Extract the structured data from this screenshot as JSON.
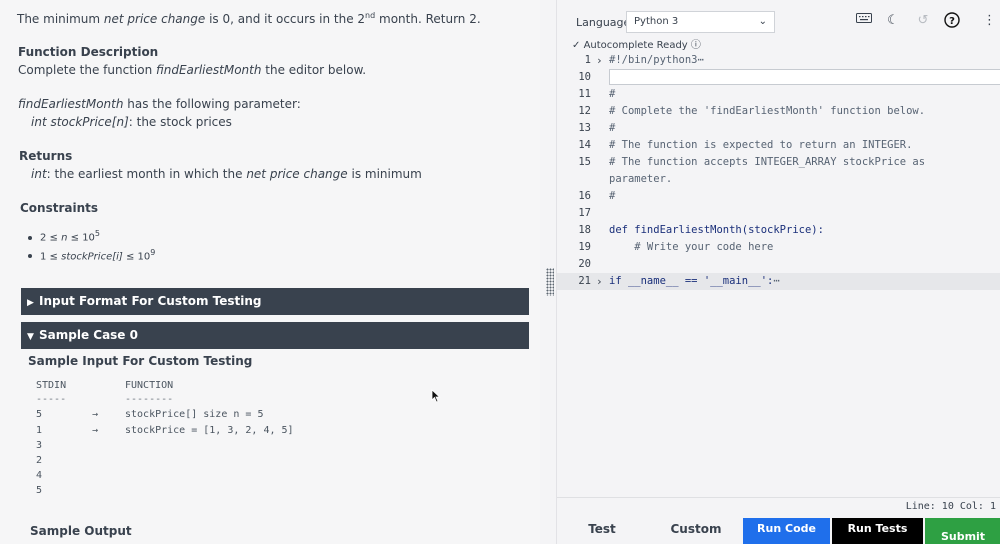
{
  "problem": {
    "intro_parts": [
      "The minimum ",
      "net price change",
      " is 0, and it occurs in the 2",
      "nd",
      " month. Return 2."
    ],
    "function_description_heading": "Function Description",
    "function_description_parts": [
      "Complete the function ",
      "findEarliestMonth",
      " the editor below."
    ],
    "param_intro_parts": [
      "findEarliestMonth",
      " has the following parameter:"
    ],
    "param_line_parts": [
      "int stockPrice[n]",
      ": the stock prices"
    ],
    "returns_heading": "Returns",
    "returns_parts": [
      "int",
      ": the earliest month in which the ",
      "net price change",
      " is minimum"
    ],
    "constraints_heading": "Constraints",
    "constraint_1_parts": [
      "2 ≤ ",
      "n",
      " ≤ 10",
      "5"
    ],
    "constraint_2_parts": [
      "1 ≤ ",
      "stockPrice[i]",
      " ≤ 10",
      "9"
    ],
    "input_format_bar": "Input Format For Custom Testing",
    "sample_case_bar": "Sample Case 0",
    "sample_input_heading": "Sample Input For Custom Testing",
    "sample_output_heading": "Sample Output",
    "stdin_header": "STDIN",
    "stdin_divider": "-----",
    "function_header": "FUNCTION",
    "function_divider": "--------",
    "stdin_rows": [
      "5",
      "1",
      "3",
      "2",
      "4",
      "5"
    ],
    "arrows": [
      "→",
      "→"
    ],
    "function_rows": [
      "stockPrice[] size n = 5",
      "stockPrice = [1, 3, 2, 4, 5]"
    ]
  },
  "editor": {
    "language_label": "Language",
    "language_value": "Python 3",
    "autocomplete": "Autocomplete Ready",
    "toolbar_icons": [
      "keyboard-icon",
      "dark-mode-icon",
      "history-icon",
      "help-icon",
      "more-icon"
    ],
    "line_numbers": [
      "1",
      "10",
      "11",
      "12",
      "13",
      "14",
      "15",
      "",
      "16",
      "17",
      "18",
      "19",
      "20",
      "21"
    ],
    "code_lines": [
      "#!/bin/python3",
      "",
      "#",
      "# Complete the 'findEarliestMonth' function below.",
      "#",
      "# The function is expected to return an INTEGER.",
      "# The function accepts INTEGER_ARRAY stockPrice as",
      "parameter.",
      "#",
      "",
      "def findEarliestMonth(stockPrice):",
      "    # Write your code here",
      "",
      "if __name__ == '__main__':"
    ],
    "fold_ellipsis": "⋯",
    "status": "Line: 10 Col: 1",
    "buttons": {
      "test": "Test",
      "custom": "Custom",
      "run_code": "Run Code",
      "run_tests": "Run Tests",
      "submit": "Submit"
    },
    "colors": {
      "run_code": "#1f6feb",
      "run_tests": "#000000",
      "submit": "#2ea043"
    }
  }
}
